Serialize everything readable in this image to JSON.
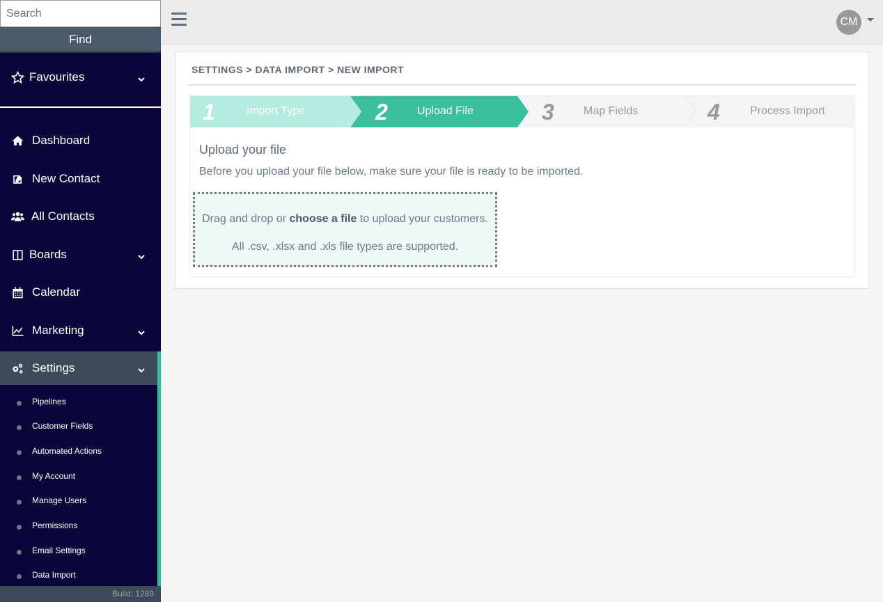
{
  "sidebar": {
    "search_placeholder": "Search",
    "find_label": "Find",
    "favourites_label": "Favourites",
    "nav": [
      {
        "label": "Dashboard",
        "icon": "home-icon"
      },
      {
        "label": "New Contact",
        "icon": "edit-icon"
      },
      {
        "label": "All Contacts",
        "icon": "users-icon"
      },
      {
        "label": "Boards",
        "icon": "columns-icon"
      },
      {
        "label": "Calendar",
        "icon": "calendar-icon"
      },
      {
        "label": "Marketing",
        "icon": "line-chart-icon"
      },
      {
        "label": "Settings",
        "icon": "gears-icon"
      }
    ],
    "settings_items": [
      "Pipelines",
      "Customer Fields",
      "Automated Actions",
      "My Account",
      "Manage Users",
      "Permissions",
      "Email Settings",
      "Data Import"
    ],
    "build": "Build: 1289"
  },
  "topbar": {
    "avatar_initials": "CM"
  },
  "breadcrumb": {
    "part1": "SETTINGS",
    "sep": ">",
    "part2": "DATA IMPORT",
    "part3": "NEW IMPORT"
  },
  "wizard": {
    "steps": [
      {
        "num": "1",
        "label": "Import Type",
        "state": "done"
      },
      {
        "num": "2",
        "label": "Upload File",
        "state": "active"
      },
      {
        "num": "3",
        "label": "Map Fields",
        "state": "pending"
      },
      {
        "num": "4",
        "label": "Process Import",
        "state": "pending"
      }
    ],
    "upload_title": "Upload your file",
    "upload_desc": "Before you upload your file below, make sure your file is ready to be imported.",
    "drop_prefix": "Drag and drop or ",
    "drop_link": "choose a file",
    "drop_suffix": " to upload your customers.",
    "drop_types": "All .csv, .xlsx and .xls file types are supported."
  },
  "colors": {
    "sidebar_bg": "#0a0639",
    "accent": "#3fb89a",
    "step_done": "#b3ebe0",
    "step_active": "#3cbf9c",
    "step_pending": "#f4f4f4"
  }
}
